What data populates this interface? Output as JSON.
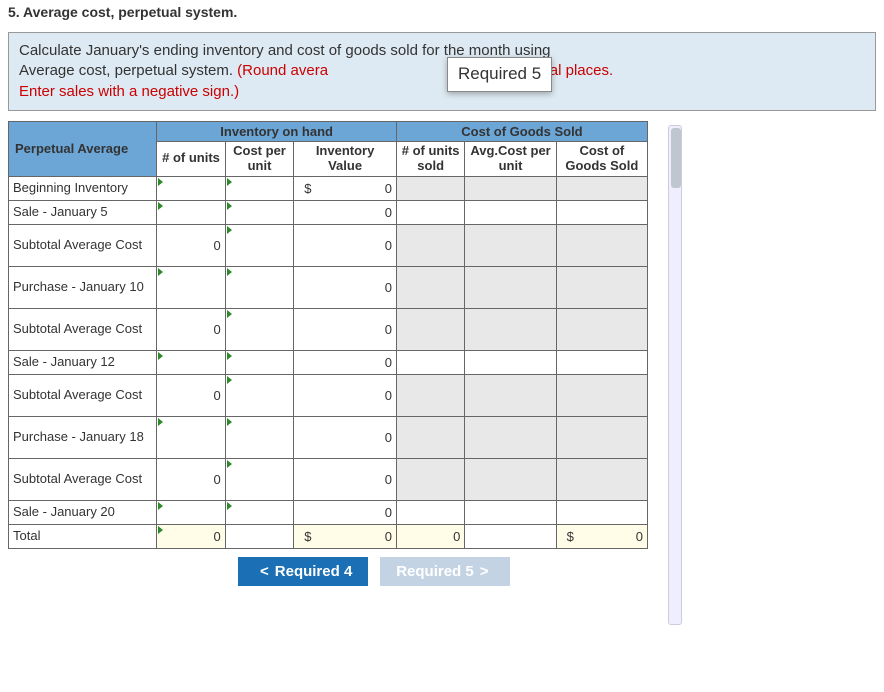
{
  "title": "5. Average cost, perpetual system.",
  "instruction": {
    "line1": "Calculate January's ending inventory and cost of goods sold for the month using",
    "line2a": "Average cost, perpetual system. ",
    "line2b": "(Round avera",
    "tooltip": "Required 5",
    "line2c": "t to 4 decimal places.",
    "line3": "Enter sales with a negative sign.)"
  },
  "headers": {
    "corner": "Perpetual Average",
    "inv_on_hand": "Inventory on hand",
    "cogs": "Cost of Goods Sold",
    "num_units": "# of units",
    "cost_per_unit": "Cost per unit",
    "inv_value": "Inventory Value",
    "num_units_sold": "# of units sold",
    "avg_cost_per_unit": "Avg.Cost per unit",
    "cost_goods_sold": "Cost of Goods Sold"
  },
  "rows": [
    {
      "label": "Beginning Inventory",
      "units": "",
      "cpu": "",
      "inv_currency": "$",
      "inv_val": "0",
      "sold": "",
      "avg": "",
      "cogs": ""
    },
    {
      "label": "Sale - January 5",
      "units": "",
      "cpu": "",
      "inv_currency": "",
      "inv_val": "0",
      "sold": "",
      "avg": "",
      "cogs": ""
    },
    {
      "label": "Subtotal Average Cost",
      "units": "0",
      "cpu": "",
      "inv_currency": "",
      "inv_val": "0",
      "sold": "",
      "avg": "",
      "cogs": ""
    },
    {
      "label": "Purchase - January 10",
      "units": "",
      "cpu": "",
      "inv_currency": "",
      "inv_val": "0",
      "sold": "",
      "avg": "",
      "cogs": ""
    },
    {
      "label": "Subtotal Average Cost",
      "units": "0",
      "cpu": "",
      "inv_currency": "",
      "inv_val": "0",
      "sold": "",
      "avg": "",
      "cogs": ""
    },
    {
      "label": "Sale - January 12",
      "units": "",
      "cpu": "",
      "inv_currency": "",
      "inv_val": "0",
      "sold": "",
      "avg": "",
      "cogs": ""
    },
    {
      "label": "Subtotal Average Cost",
      "units": "0",
      "cpu": "",
      "inv_currency": "",
      "inv_val": "0",
      "sold": "",
      "avg": "",
      "cogs": ""
    },
    {
      "label": "Purchase - January 18",
      "units": "",
      "cpu": "",
      "inv_currency": "",
      "inv_val": "0",
      "sold": "",
      "avg": "",
      "cogs": ""
    },
    {
      "label": "Subtotal Average Cost",
      "units": "0",
      "cpu": "",
      "inv_currency": "",
      "inv_val": "0",
      "sold": "",
      "avg": "",
      "cogs": ""
    },
    {
      "label": "Sale - January 20",
      "units": "",
      "cpu": "",
      "inv_currency": "",
      "inv_val": "0",
      "sold": "",
      "avg": "",
      "cogs": ""
    },
    {
      "label": "Total",
      "units": "0",
      "cpu": "",
      "inv_currency": "$",
      "inv_val": "0",
      "sold": "0",
      "avg": "",
      "cogs_currency": "$",
      "cogs": "0"
    }
  ],
  "buttons": {
    "prev": "Required 4",
    "next": "Required 5"
  }
}
